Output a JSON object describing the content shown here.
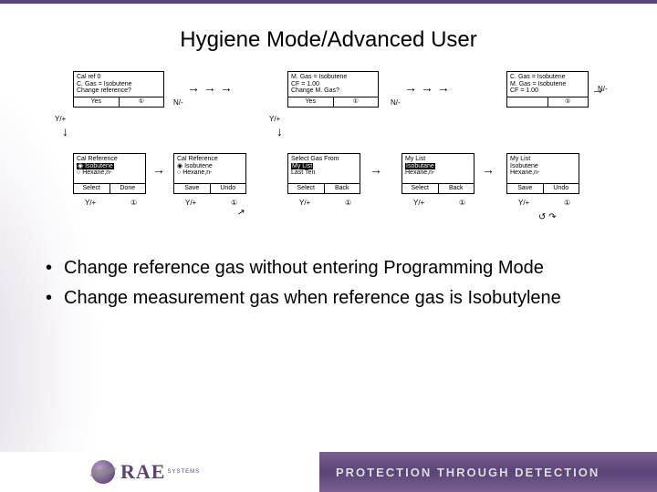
{
  "title": "Hygiene Mode/Advanced User",
  "bullets": [
    "Change reference gas without entering Programming Mode",
    "Change measurement gas when reference gas is Isobutylene"
  ],
  "logo": {
    "brand": "RAE",
    "sub": "SYSTEMS"
  },
  "tagline": "PROTECTION THROUGH DETECTION",
  "screens": {
    "top1": {
      "l1": "Cal ref 0",
      "l2": "C. Gas = Isobutene",
      "l3": "Change reference?",
      "b1": "Yes",
      "b2": "①"
    },
    "top2": {
      "l1": "M. Gas = Isobutene",
      "l2": "CF = 1.00",
      "l3": "Change M. Gas?",
      "b1": "Yes",
      "b2": "①"
    },
    "top3": {
      "l1": "C. Gas = Isobutene",
      "l2": "M. Gas = Isobutene",
      "l3": "CF = 1.00",
      "b2": "①"
    },
    "b1": {
      "t": "Cal Reference",
      "o1": "Isobutene",
      "o2": "Hexane,n-",
      "f1": "Select",
      "f2": "Done"
    },
    "b2": {
      "t": "Cal Reference",
      "o1": "Isobutene",
      "o2": "Hexane,n-",
      "f1": "Save",
      "f2": "Undo"
    },
    "b3": {
      "t": "Select Gas From",
      "o1": "My List",
      "o2": "Last Ten",
      "f1": "Select",
      "f2": "Back"
    },
    "b4": {
      "t": "My List",
      "o1": "Isobutane",
      "o2": "Hexane,n-",
      "f1": "Select",
      "f2": "Back"
    },
    "b5": {
      "t": "My List",
      "o1": "Isobutene",
      "o2": "Hexane,n-",
      "f1": "Save",
      "f2": "Undo"
    }
  },
  "btn_labels": {
    "yplus": "Y/+",
    "nminus": "N/-",
    "down": "①"
  }
}
